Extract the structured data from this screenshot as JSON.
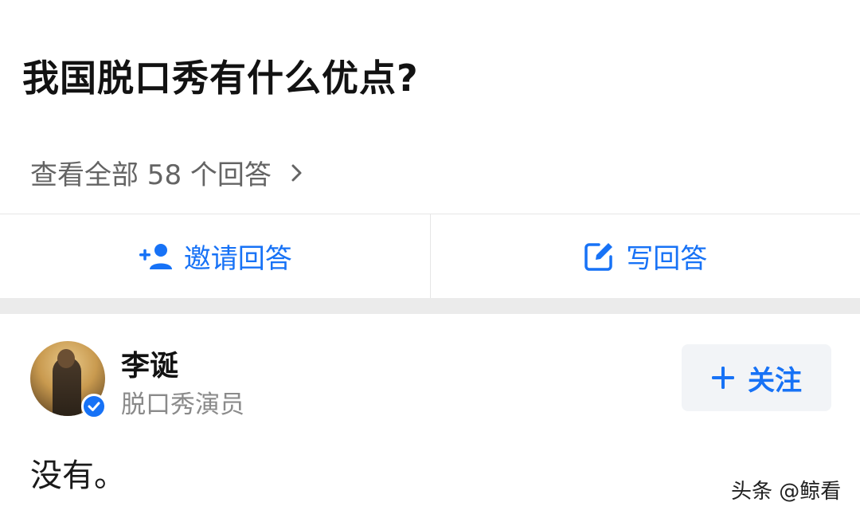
{
  "question": {
    "title": "我国脱口秀有什么优点?",
    "view_all_label": "查看全部 58 个回答"
  },
  "actions": {
    "invite_label": "邀请回答",
    "write_label": "写回答"
  },
  "answer": {
    "author_name": "李诞",
    "author_title": "脱口秀演员",
    "follow_label": "关注",
    "content": "没有。"
  },
  "watermark": "头条 @鲸看",
  "icons": {
    "chevron": "chevron-right-icon",
    "invite": "add-person-icon",
    "write": "edit-icon",
    "verified": "verified-badge-icon",
    "follow": "plus-icon"
  },
  "colors": {
    "accent": "#1772f6",
    "muted": "#8a8a8a",
    "separator": "#ebebeb"
  }
}
